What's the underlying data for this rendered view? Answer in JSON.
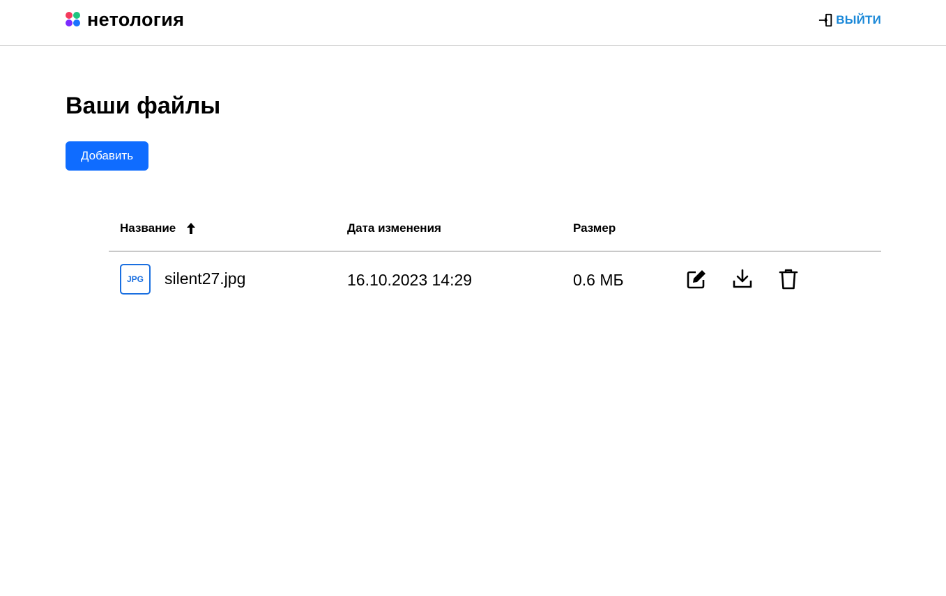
{
  "header": {
    "logo_text": "нетология",
    "logo_colors": [
      "#f43a5c",
      "#1ec57f",
      "#7c2cff",
      "#1a73ff"
    ],
    "logout_label": "ВЫЙТИ",
    "logout_icon": "logout-icon",
    "accent_color": "#1a88d8"
  },
  "page": {
    "title": "Ваши файлы",
    "add_button_label": "Добавить",
    "button_color": "#0f6cff"
  },
  "table": {
    "columns": [
      {
        "label": "Название",
        "sort": "ascending",
        "sort_icon": "arrow-up-icon"
      },
      {
        "label": "Дата изменения"
      },
      {
        "label": "Размер"
      }
    ],
    "rows": [
      {
        "type_badge": "JPG",
        "name": "silent27.jpg",
        "modified": "16.10.2023 14:29",
        "size": "0.6 МБ",
        "actions": [
          "edit-icon",
          "download-icon",
          "delete-icon"
        ]
      }
    ]
  }
}
